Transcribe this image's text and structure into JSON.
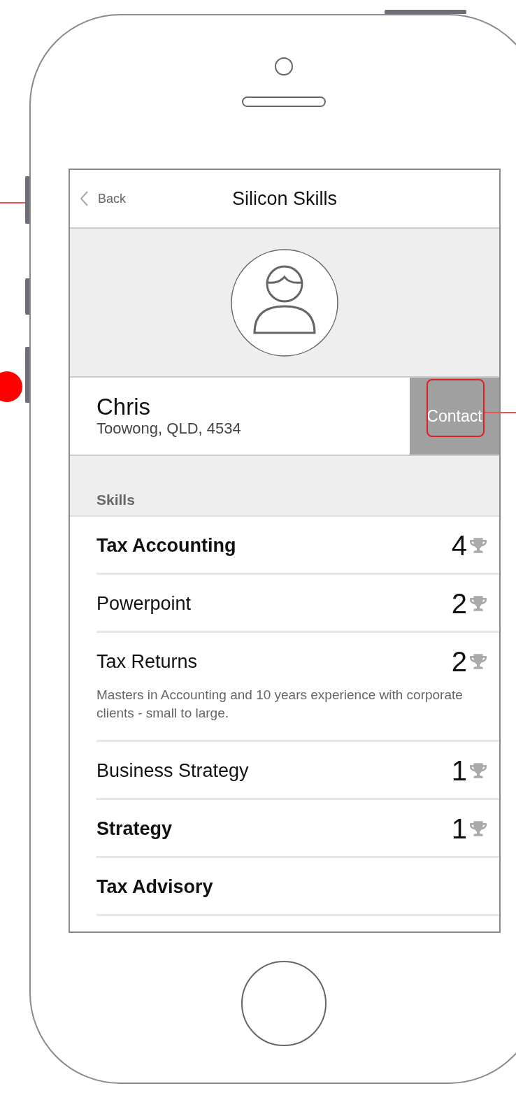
{
  "nav": {
    "back": "Back",
    "title": "Silicon Skills"
  },
  "profile": {
    "name": "Chris",
    "location": "Toowong, QLD, 4534",
    "contact": "Contact"
  },
  "section_title": "Skills",
  "skills": [
    {
      "name": "Tax Accounting",
      "bold": true,
      "rating": "4"
    },
    {
      "name": "Powerpoint",
      "bold": false,
      "rating": "2"
    },
    {
      "name": "Tax Returns",
      "bold": false,
      "rating": "2",
      "description": "Masters in Accounting and 10 years experience with corporate clients - small to large."
    },
    {
      "name": "Business Strategy",
      "bold": false,
      "rating": "1"
    },
    {
      "name": "Strategy",
      "bold": true,
      "rating": "1"
    },
    {
      "name": "Tax Advisory",
      "bold": true
    }
  ]
}
